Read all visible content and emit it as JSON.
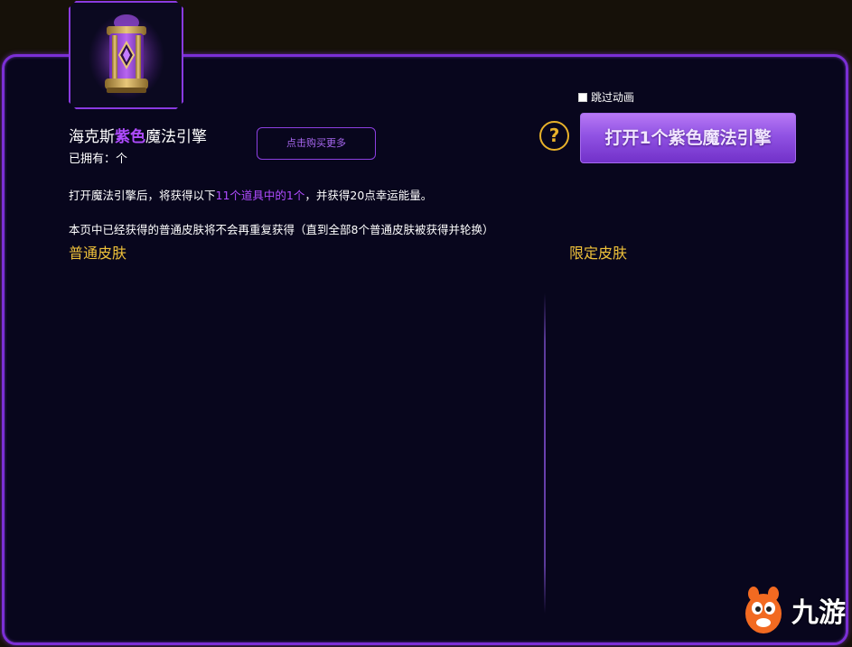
{
  "item": {
    "name_prefix": "海克斯",
    "name_highlight": "紫色",
    "name_suffix": "魔法引擎",
    "owned_label": "已拥有：个"
  },
  "buttons": {
    "buy_more": "点击购买更多",
    "help": "?",
    "open": "打开1个紫色魔法引擎"
  },
  "skip_animation": {
    "label": "跳过动画"
  },
  "description": {
    "line1_prefix": "打开魔法引擎后，将获得以下",
    "line1_highlight": "11个道具中的1个",
    "line1_suffix": "，并获得20点幸运能量。",
    "line2": "本页中已经获得的普通皮肤将不会再重复获得（直到全部8个普通皮肤被获得并轮换）"
  },
  "sections": {
    "normal": "普通皮肤",
    "limited": "限定皮肤"
  },
  "watermark": {
    "text": "九游"
  },
  "colors": {
    "accent_purple": "#b04cff",
    "border_purple": "#7b2fd6",
    "gold": "#f0c23a",
    "panel_bg": "#08061d"
  },
  "icons": {
    "item": "magic-engine-chest-icon",
    "watermark": "jiuyou-mascot-icon"
  }
}
